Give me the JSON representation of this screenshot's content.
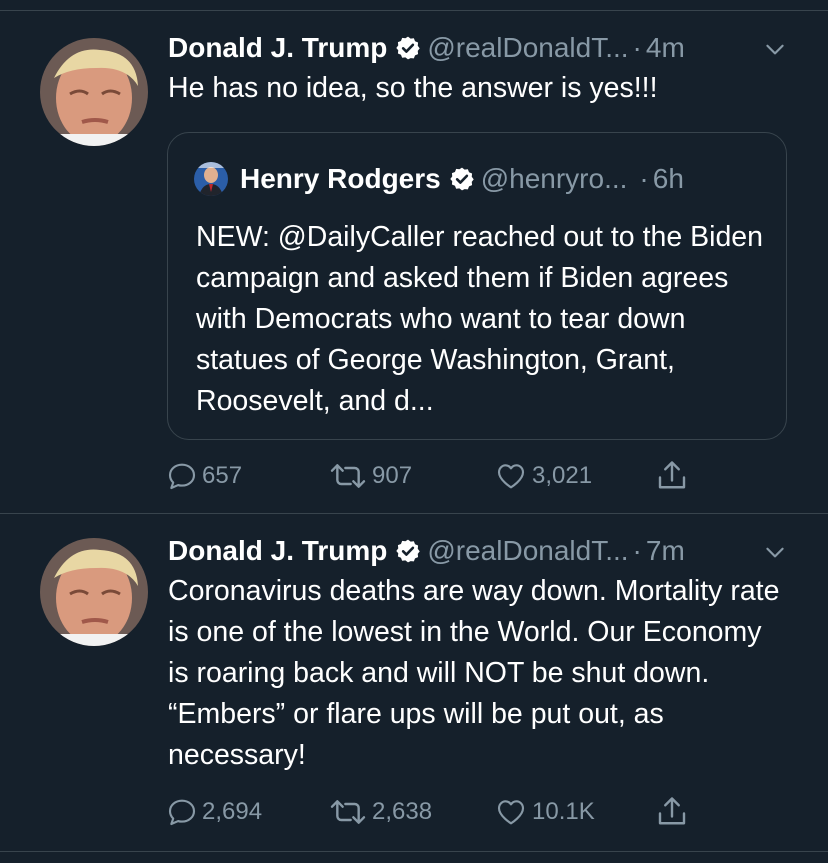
{
  "colors": {
    "background": "#15202b",
    "divider": "#38444d",
    "secondary_text": "#8899a6",
    "verified": "#ffffff"
  },
  "tweets": [
    {
      "name": "Donald J. Trump",
      "handle": "@realDonaldT...",
      "separator": "·",
      "time": "4m",
      "text": "He has no idea, so the answer is yes!!!",
      "quote": {
        "name": "Henry Rodgers",
        "handle": "@henryro...",
        "separator": "·",
        "time": "6h",
        "text": "NEW: @DailyCaller reached out to the Biden campaign and asked them if Biden agrees with Democrats who want to tear down statues of George Washington, Grant, Roosevelt, and d..."
      },
      "replies": "657",
      "retweets": "907",
      "likes": "3,021",
      "icons": [
        "reply-icon",
        "retweet-icon",
        "like-icon",
        "share-icon"
      ]
    },
    {
      "name": "Donald J. Trump",
      "handle": "@realDonaldT...",
      "separator": "·",
      "time": "7m",
      "text": "Coronavirus deaths are way down. Mortality rate is one of the lowest in the World. Our Economy is roaring back and will NOT be shut down. “Embers” or flare ups will be put out, as necessary!",
      "replies": "2,694",
      "retweets": "2,638",
      "likes": "10.1K",
      "icons": [
        "reply-icon",
        "retweet-icon",
        "like-icon",
        "share-icon"
      ]
    }
  ]
}
